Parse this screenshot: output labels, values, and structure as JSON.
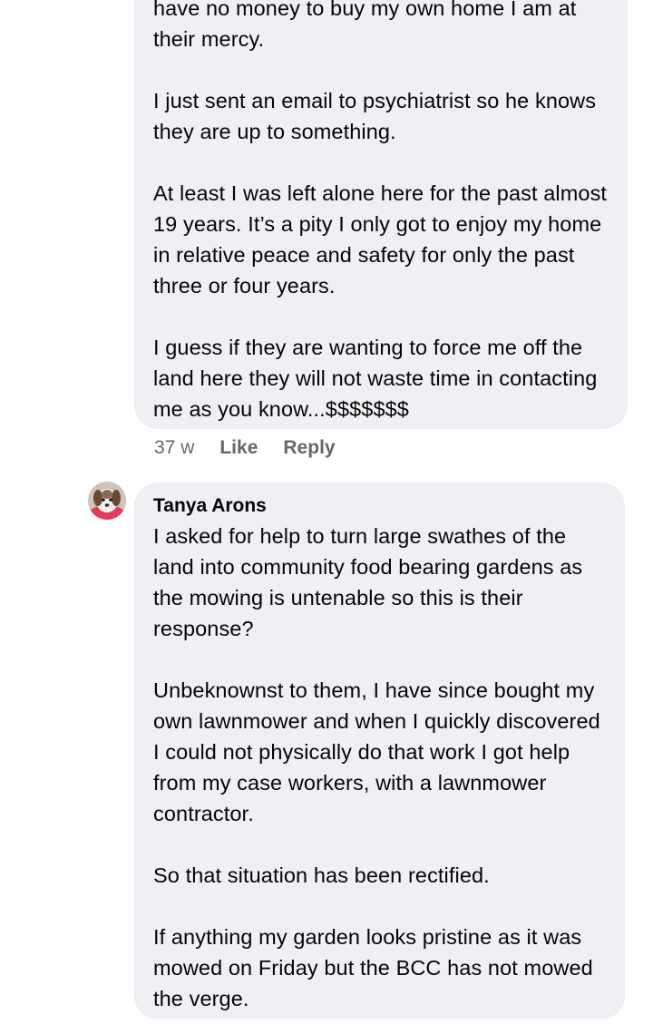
{
  "comment1": {
    "paragraphs": [
      "have no money to buy my own home I am at their mercy.",
      "I just sent an email to psychiatrist so he knows they are up to something.",
      "At least I was left alone here for the past almost 19 years.  It’s a pity I only got to enjoy my home in relative peace and safety for only the past three or four years.",
      "I guess if they are wanting to force me off the land here they will not waste time in contacting me as you know...$$$$$$$"
    ],
    "timestamp": "37 w",
    "like_label": "Like",
    "reply_label": "Reply"
  },
  "comment2": {
    "author": "Tanya Arons",
    "avatar_icon": "profile-photo-dog",
    "paragraphs": [
      "I asked for help to turn large swathes of the land into community food bearing gardens as the mowing is untenable so this is their response?",
      "Unbeknownst to them, I have since bought my own lawnmower and when I quickly discovered I could not physically do that work I got help from my case workers, with a lawnmower contractor.",
      "So that situation has been rectified.",
      "If anything my garden looks pristine as it was mowed on Friday but the BCC has not mowed the verge."
    ]
  },
  "colors": {
    "bubble_bg": "#eff0f3",
    "meta_text": "#65676b",
    "body_text": "#050505"
  }
}
